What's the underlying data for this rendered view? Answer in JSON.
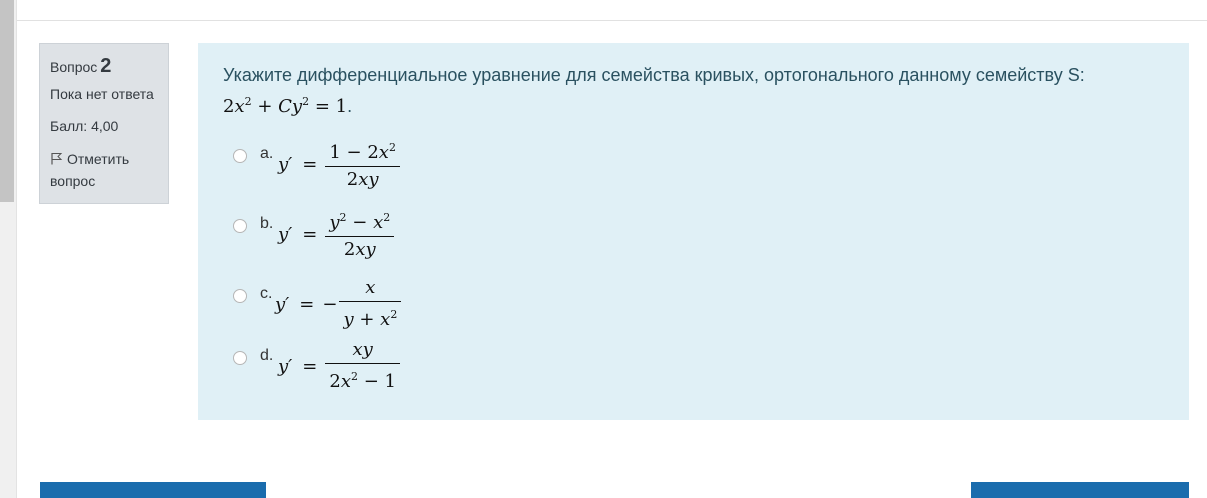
{
  "info": {
    "question_label": "Вопрос",
    "question_number": "2",
    "state": "Пока нет ответа",
    "grade": "Балл: 4,00",
    "flag_label": "Отметить вопрос",
    "flag_icon": "flag-outline-icon"
  },
  "question": {
    "text": "Укажите дифференциальное уравнение для семейства кривых, ортогонального данному семейству S:",
    "equation": "2x² + Cy² = 1."
  },
  "answers": [
    {
      "letter": "a.",
      "lhs": "y′",
      "sign": "",
      "numerator": "1 − 2x²",
      "denominator": "2xy"
    },
    {
      "letter": "b.",
      "lhs": "y′",
      "sign": "",
      "numerator": "y² − x²",
      "denominator": "2xy"
    },
    {
      "letter": "c.",
      "lhs": "y′",
      "sign": "−",
      "numerator": "x",
      "denominator": "y + x²"
    },
    {
      "letter": "d.",
      "lhs": "y′",
      "sign": "",
      "numerator": "xy",
      "denominator": "2x² − 1"
    }
  ],
  "colors": {
    "content_bg": "#e0f0f6",
    "info_bg": "#dee2e6",
    "button_blue": "#1a6cad",
    "question_text": "#2a5160"
  }
}
